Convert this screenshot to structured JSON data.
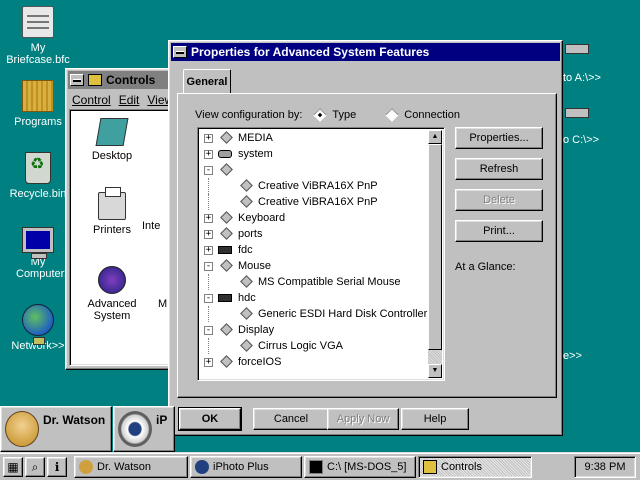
{
  "desktop": {
    "icons": [
      {
        "label": "My Briefcase.bfc",
        "icon": "briefcase-icon"
      },
      {
        "label": "Programs",
        "icon": "folder-icon"
      },
      {
        "label": "Recycle.bin",
        "icon": "recycle-bin-icon"
      },
      {
        "label": "My Computer>>",
        "icon": "computer-icon"
      },
      {
        "label": "Network>>",
        "icon": "network-icon"
      }
    ],
    "right_labels": [
      "to A:\\>>",
      "o C:\\>>",
      "e>>"
    ]
  },
  "controls_window": {
    "title": "Controls",
    "menu": [
      "Control",
      "Edit",
      "View"
    ],
    "items": [
      {
        "label": "Desktop",
        "icon": "desktop-icon"
      },
      {
        "label": "Printers",
        "icon": "printer-icon"
      },
      {
        "label": "Inte",
        "icon": "international-icon"
      },
      {
        "label": "Advanced System",
        "icon": "advanced-system-icon"
      },
      {
        "label": "M",
        "icon": "mouse-icon"
      }
    ]
  },
  "properties_dialog": {
    "title": "Properties for Advanced System Features",
    "tab": "General",
    "view_config": {
      "label": "View configuration by:",
      "options": [
        {
          "label": "Type",
          "selected": true
        },
        {
          "label": "Connection",
          "selected": false
        }
      ]
    },
    "tree": [
      {
        "label": "MEDIA",
        "level": 0,
        "expander": "+",
        "icon": "device-diamond-icon"
      },
      {
        "label": "system",
        "level": 0,
        "expander": "+",
        "icon": "system-icon"
      },
      {
        "label": "",
        "level": 0,
        "expander": "-",
        "icon": "device-diamond-icon"
      },
      {
        "label": "Creative ViBRA16X PnP",
        "level": 1,
        "expander": "",
        "icon": "device-diamond-icon"
      },
      {
        "label": "Creative ViBRA16X PnP",
        "level": 1,
        "expander": "",
        "icon": "device-diamond-icon"
      },
      {
        "label": "Keyboard",
        "level": 0,
        "expander": "+",
        "icon": "device-diamond-icon"
      },
      {
        "label": "ports",
        "level": 0,
        "expander": "+",
        "icon": "device-diamond-icon"
      },
      {
        "label": "fdc",
        "level": 0,
        "expander": "+",
        "icon": "controller-icon"
      },
      {
        "label": "Mouse",
        "level": 0,
        "expander": "-",
        "icon": "device-diamond-icon"
      },
      {
        "label": "MS Compatible Serial Mouse",
        "level": 1,
        "expander": "",
        "icon": "device-diamond-icon"
      },
      {
        "label": "hdc",
        "level": 0,
        "expander": "-",
        "icon": "controller-icon"
      },
      {
        "label": "Generic ESDI Hard Disk Controller",
        "level": 1,
        "expander": "",
        "icon": "device-diamond-icon"
      },
      {
        "label": "Display",
        "level": 0,
        "expander": "-",
        "icon": "device-diamond-icon"
      },
      {
        "label": "Cirrus Logic VGA",
        "level": 1,
        "expander": "",
        "icon": "device-diamond-icon"
      },
      {
        "label": "forceIOS",
        "level": 0,
        "expander": "+",
        "icon": "device-diamond-icon"
      }
    ],
    "side_buttons": [
      {
        "label": "Properties...",
        "enabled": true
      },
      {
        "label": "Refresh",
        "enabled": true
      },
      {
        "label": "Delete",
        "enabled": false
      },
      {
        "label": "Print...",
        "enabled": true
      }
    ],
    "at_a_glance": "At a Glance:",
    "bottom_buttons": [
      {
        "label": "OK",
        "enabled": true
      },
      {
        "label": "Cancel",
        "enabled": true
      },
      {
        "label": "Apply Now",
        "enabled": false
      },
      {
        "label": "Help",
        "enabled": true
      }
    ]
  },
  "dock": [
    {
      "label": "Dr. Watson",
      "icon": "dr-watson-icon"
    },
    {
      "label": "iP",
      "icon": "iphoto-eye-icon"
    }
  ],
  "taskbar": {
    "quick_icons": [
      "start-icon",
      "search-icon",
      "info-icon"
    ],
    "tasks": [
      {
        "label": "Dr. Watson",
        "icon": "dr-watson-icon"
      },
      {
        "label": "iPhoto Plus",
        "icon": "iphoto-icon"
      },
      {
        "label": "C:\\ [MS-DOS_5]",
        "icon": "dos-icon"
      },
      {
        "label": "Controls",
        "icon": "folder-icon"
      }
    ],
    "clock": "9:38 PM"
  }
}
